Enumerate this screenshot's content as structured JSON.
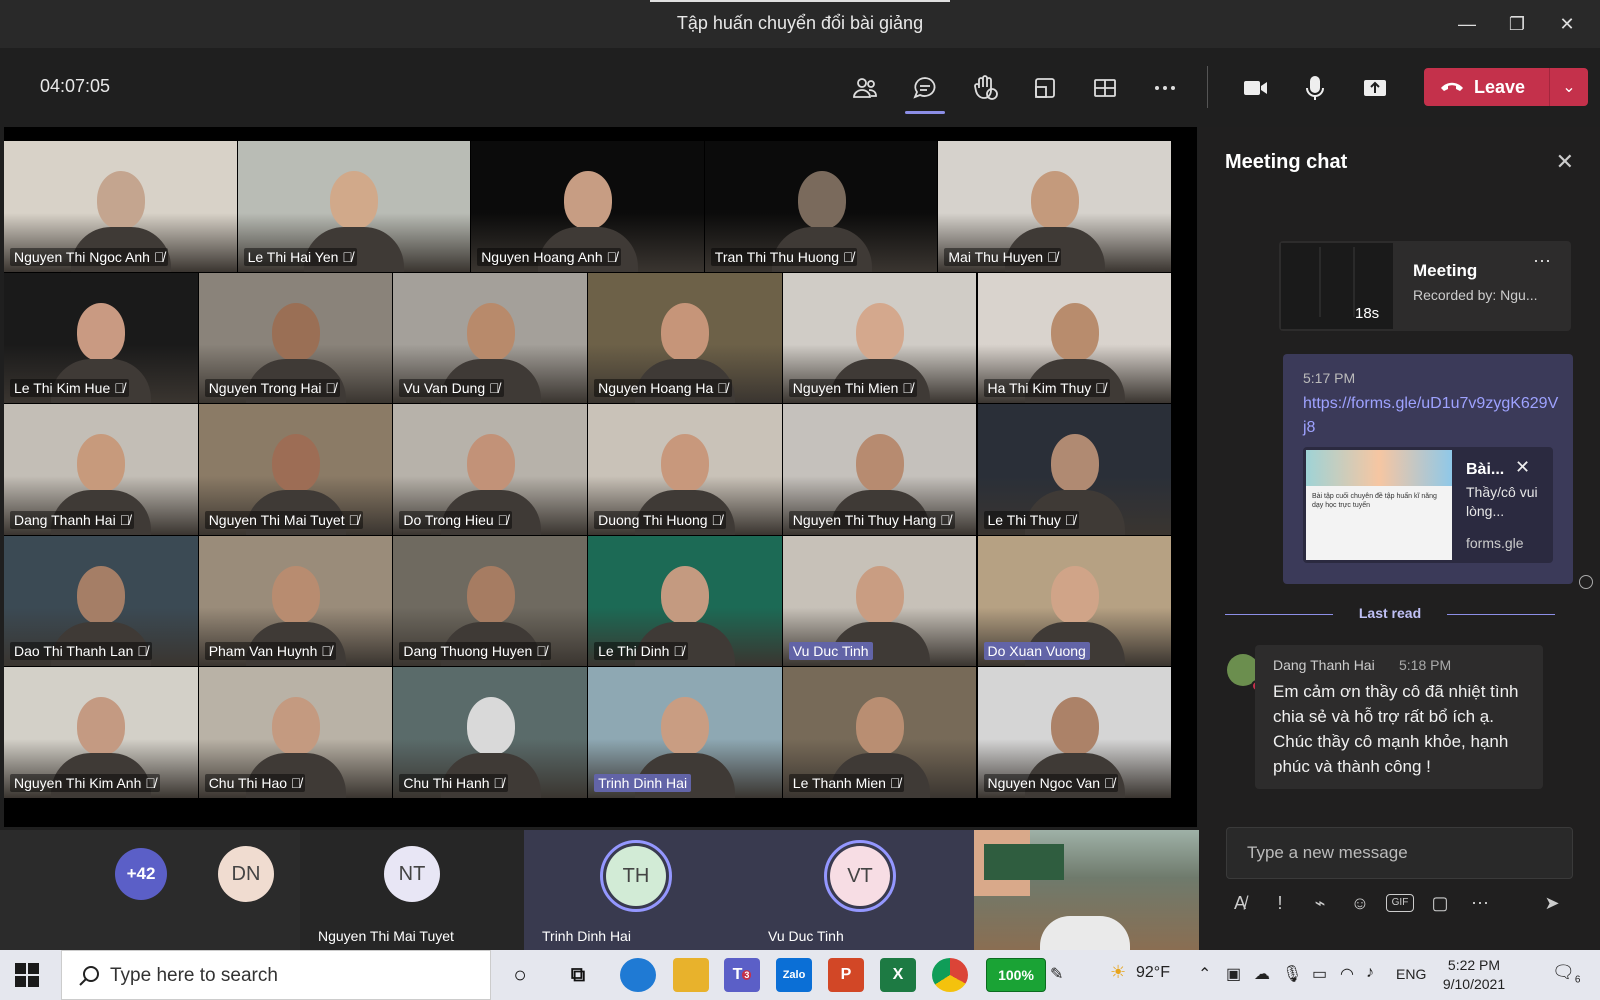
{
  "window": {
    "title": "Tập huấn chuyển đổi bài giảng",
    "minimize": "—",
    "restore": "❐",
    "close": "✕"
  },
  "toolbar": {
    "timer": "04:07:05",
    "leave_label": "Leave",
    "leave_color": "#c4314b",
    "accent": "#6264a7",
    "icons": [
      "people-icon",
      "chat-icon",
      "reactions-icon",
      "share-tray-icon",
      "rooms-icon",
      "more-icon",
      "camera-icon",
      "mic-icon",
      "share-icon"
    ]
  },
  "participants": [
    {
      "name": "Nguyen Thi Ngoc Anh",
      "muted": true
    },
    {
      "name": "Le Thi Hai Yen",
      "muted": true
    },
    {
      "name": "Nguyen Hoang Anh",
      "muted": true
    },
    {
      "name": "Tran Thi Thu Huong",
      "muted": true
    },
    {
      "name": "Mai Thu Huyen",
      "muted": true
    },
    {
      "name": "Le Thi Kim Hue",
      "muted": true
    },
    {
      "name": "Nguyen Trong Hai",
      "muted": true
    },
    {
      "name": "Vu Van Dung",
      "muted": true
    },
    {
      "name": "Nguyen Hoang Ha",
      "muted": true
    },
    {
      "name": "Nguyen Thi Mien",
      "muted": true
    },
    {
      "name": "Ha Thi Kim Thuy",
      "muted": true
    },
    {
      "name": "Dang Thanh Hai",
      "muted": true
    },
    {
      "name": "Nguyen Thi Mai Tuyet",
      "muted": true
    },
    {
      "name": "Do Trong Hieu",
      "muted": true
    },
    {
      "name": "Duong Thi Huong",
      "muted": true
    },
    {
      "name": "Nguyen Thi Thuy Hang",
      "muted": true
    },
    {
      "name": "Le Thi Thuy",
      "muted": true
    },
    {
      "name": "Dao Thi Thanh Lan",
      "muted": true
    },
    {
      "name": "Pham Van Huynh",
      "muted": true
    },
    {
      "name": "Dang Thuong Huyen",
      "muted": true
    },
    {
      "name": "Le Thi Dinh",
      "muted": true
    },
    {
      "name": "Vu Duc Tinh",
      "muted": false
    },
    {
      "name": "Do Xuan Vuong",
      "muted": false
    },
    {
      "name": "Nguyen Thi Kim Anh",
      "muted": true
    },
    {
      "name": "Chu Thi Hao",
      "muted": true
    },
    {
      "name": "Chu Thi Hanh",
      "muted": true
    },
    {
      "name": "Trinh Dinh Hai",
      "muted": false
    },
    {
      "name": "Le Thanh Mien",
      "muted": true
    },
    {
      "name": "Nguyen Ngoc Van",
      "muted": true
    }
  ],
  "strip": {
    "overflow": "+42",
    "avatars": [
      {
        "initials": "DN",
        "name": ""
      },
      {
        "initials": "NT",
        "name": "Nguyen Thi Mai Tuyet"
      },
      {
        "initials": "TH",
        "name": "Trinh Dinh Hai"
      },
      {
        "initials": "VT",
        "name": "Vu Duc Tinh"
      }
    ]
  },
  "chat": {
    "header": "Meeting chat",
    "meeting_card": {
      "title": "Meeting",
      "subtitle": "Recorded by: Ngu...",
      "duration": "18s"
    },
    "message1": {
      "time": "5:17 PM",
      "link": "https://forms.gle/uD1u7v9zygK629Vj8",
      "preview_title": "Bài...",
      "preview_desc": "Thầy/cô vui lòng...",
      "preview_domain": "forms.gle",
      "preview_image_text": "Bài tập cuối chuyên đề tập huấn kĩ năng dạy học trực tuyến"
    },
    "last_read": "Last read",
    "message2": {
      "sender": "Dang Thanh Hai",
      "time": "5:18 PM",
      "text": "Em cảm ơn thầy cô đã nhiệt tình chia sẻ và hỗ trợ rất bổ ích ạ. Chúc thầy cô mạnh khỏe, hạnh phúc và thành công !"
    },
    "compose_placeholder": "Type a new message"
  },
  "taskbar": {
    "search_placeholder": "Type here to search",
    "apps": [
      "task-view",
      "edge",
      "file-explorer",
      "teams",
      "zalo",
      "powerpoint",
      "excel",
      "chrome",
      "battery-app"
    ],
    "teams_badge": "3",
    "zalo_label": "Zalo",
    "battery_percent": "100%",
    "weather": "92°F",
    "language": "ENG",
    "time": "5:22 PM",
    "date": "9/10/2021",
    "notifications": "6"
  }
}
